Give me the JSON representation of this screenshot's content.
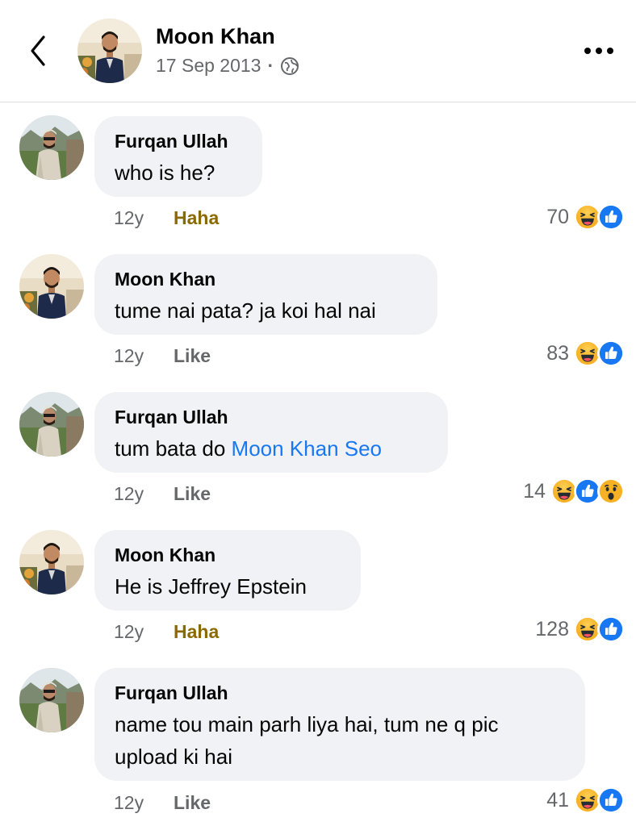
{
  "header": {
    "name": "Moon Khan",
    "date": "17 Sep 2013",
    "separator": "·",
    "privacy_icon": "globe-icon",
    "more_icon": "more-horizontal-icon",
    "back_icon": "chevron-left-icon"
  },
  "comments": [
    {
      "author": "Furqan Ullah",
      "text": "who is he?",
      "time": "12y",
      "action": "Haha",
      "count": "70",
      "reactions": [
        "haha",
        "like"
      ]
    },
    {
      "author": "Moon Khan",
      "text": "tume nai pata? ja koi hal nai",
      "time": "12y",
      "action": "Like",
      "count": "83",
      "reactions": [
        "haha",
        "like"
      ]
    },
    {
      "author": "Furqan Ullah",
      "text_prefix": "tum bata do ",
      "mention": "Moon Khan Seo",
      "time": "12y",
      "action": "Like",
      "count": "14",
      "reactions": [
        "haha",
        "like",
        "wow"
      ]
    },
    {
      "author": "Moon Khan",
      "text": "He is Jeffrey Epstein",
      "time": "12y",
      "action": "Haha",
      "count": "128",
      "reactions": [
        "haha",
        "like"
      ]
    },
    {
      "author": "Furqan Ullah",
      "text_line1": "name tou main parh liya hai, tum ne q pic",
      "text_line2": "upload ki hai",
      "time": "12y",
      "action": "Like",
      "count": "41",
      "reactions": [
        "haha",
        "like"
      ]
    }
  ],
  "colors": {
    "bubble": "#f0f2f5",
    "mention": "#1877f2",
    "like_blue": "#1877f2",
    "haha_action": "#8a6a00",
    "secondary_text": "#65676b"
  }
}
